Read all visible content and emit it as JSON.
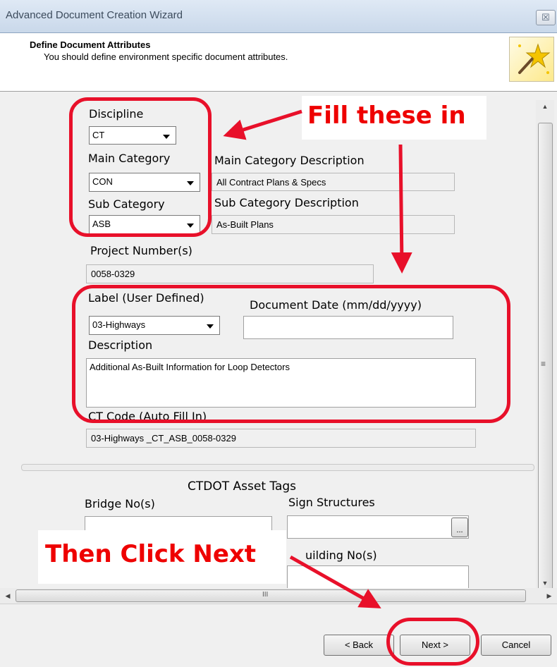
{
  "window": {
    "title": "Advanced Document Creation Wizard",
    "close_icon": "close-icon",
    "close_glyph": "☒"
  },
  "header": {
    "title": "Define Document Attributes",
    "subtitle": "You should define environment specific document attributes.",
    "icon": "magic-wand-icon"
  },
  "form": {
    "discipline": {
      "label": "Discipline",
      "value": "CT"
    },
    "main_category": {
      "label": "Main Category",
      "value": "CON"
    },
    "main_category_description": {
      "label": "Main Category Description",
      "value": "All Contract Plans & Specs"
    },
    "sub_category": {
      "label": "Sub Category",
      "value": "ASB"
    },
    "sub_category_description": {
      "label": "Sub Category Description",
      "value": "As-Built Plans"
    },
    "project_numbers": {
      "label": "Project Number(s)",
      "value": "0058-0329"
    },
    "label_user_defined": {
      "label": "Label (User Defined)",
      "value": "03-Highways"
    },
    "document_date": {
      "label": "Document Date (mm/dd/yyyy)",
      "value": ""
    },
    "description": {
      "label": "Description",
      "value": "Additional As-Built Information for Loop Detectors"
    },
    "ct_code": {
      "label": "CT Code (Auto Fill In)",
      "value": "03-Highways _CT_ASB_0058-0329"
    }
  },
  "asset_tags": {
    "title": "CTDOT Asset Tags",
    "bridge_label": "Bridge No(s)",
    "sign_label": "Sign Structures",
    "building_label": "uilding No(s)",
    "browse_label": "..."
  },
  "annotations": {
    "fill": "Fill these in",
    "click": "Then Click Next"
  },
  "buttons": {
    "back": "< Back",
    "next": "Next >",
    "cancel": "Cancel"
  },
  "scrollbar": {
    "hscroll_grip": "III",
    "vscroll_grip": "≡"
  },
  "colors": {
    "annotation_red": "#e8102a"
  }
}
